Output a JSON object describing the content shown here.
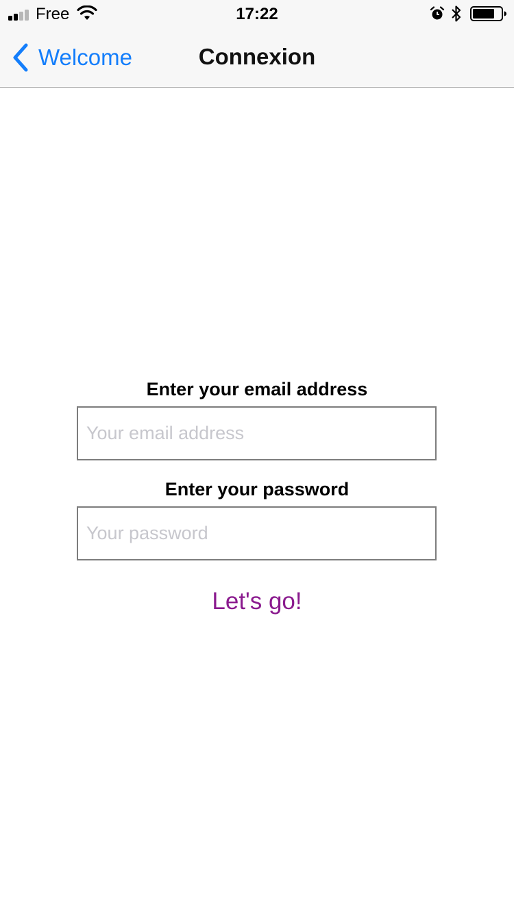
{
  "status_bar": {
    "carrier": "Free",
    "time": "17:22",
    "icons": [
      "signal-icon",
      "wifi-icon",
      "alarm-icon",
      "bluetooth-icon",
      "battery-icon"
    ]
  },
  "nav_bar": {
    "back_label": "Welcome",
    "title": "Connexion",
    "accent_color": "#147efb"
  },
  "form": {
    "email_label": "Enter your email address",
    "email_placeholder": "Your email address",
    "email_value": "",
    "password_label": "Enter your password",
    "password_placeholder": "Your password",
    "password_value": "",
    "submit_label": "Let's go!",
    "submit_color": "#8a1a8e"
  }
}
